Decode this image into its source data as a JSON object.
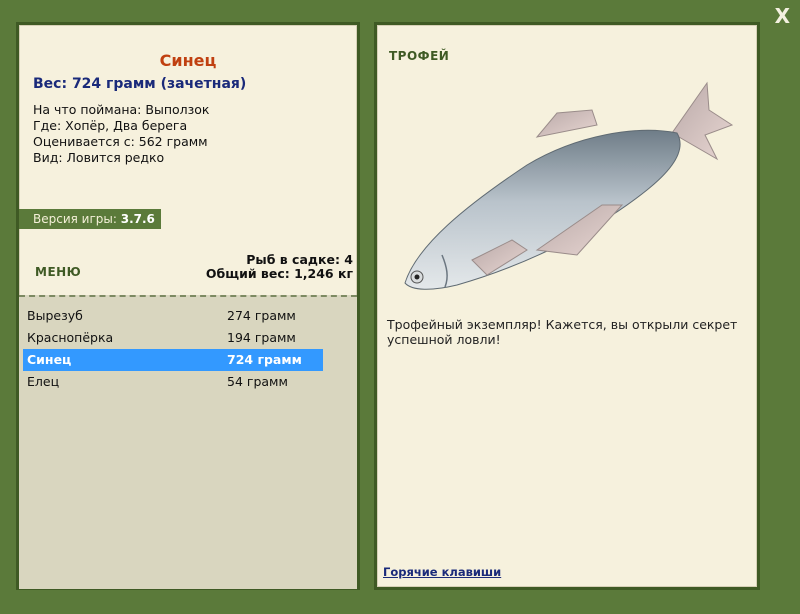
{
  "close_label": "X",
  "left": {
    "fish_name": "Синец",
    "weight_line": "Вес: 724 грамм (зачетная)",
    "info": [
      "На что поймана: Выползок",
      "Где: Хопёр, Два берега",
      "Оценивается с: 562 грамм",
      "Вид: Ловится редко"
    ],
    "version_label": "Версия игры:",
    "version_value": "3.7.6",
    "menu_label": "МЕНЮ",
    "basket_count": "Рыб в садке: 4",
    "basket_weight": "Общий вес: 1,246 кг",
    "fish_list": [
      {
        "name": "Вырезуб",
        "weight": "274 грамм"
      },
      {
        "name": "Краснопёрка",
        "weight": "194 грамм"
      },
      {
        "name": "Синец",
        "weight": "724 грамм"
      },
      {
        "name": "Елец",
        "weight": "54 грамм"
      }
    ]
  },
  "right": {
    "trophy_label": "ТРОФЕЙ",
    "trophy_text": "Трофейный экземпляр! Кажется, вы открыли секрет успешной ловли!",
    "hotkeys_label": "Горячие клавиши"
  },
  "colors": {
    "background": "#5b7a3a",
    "panel": "#f6f1dd",
    "title": "#c04010",
    "selected_row": "#3399ff"
  }
}
